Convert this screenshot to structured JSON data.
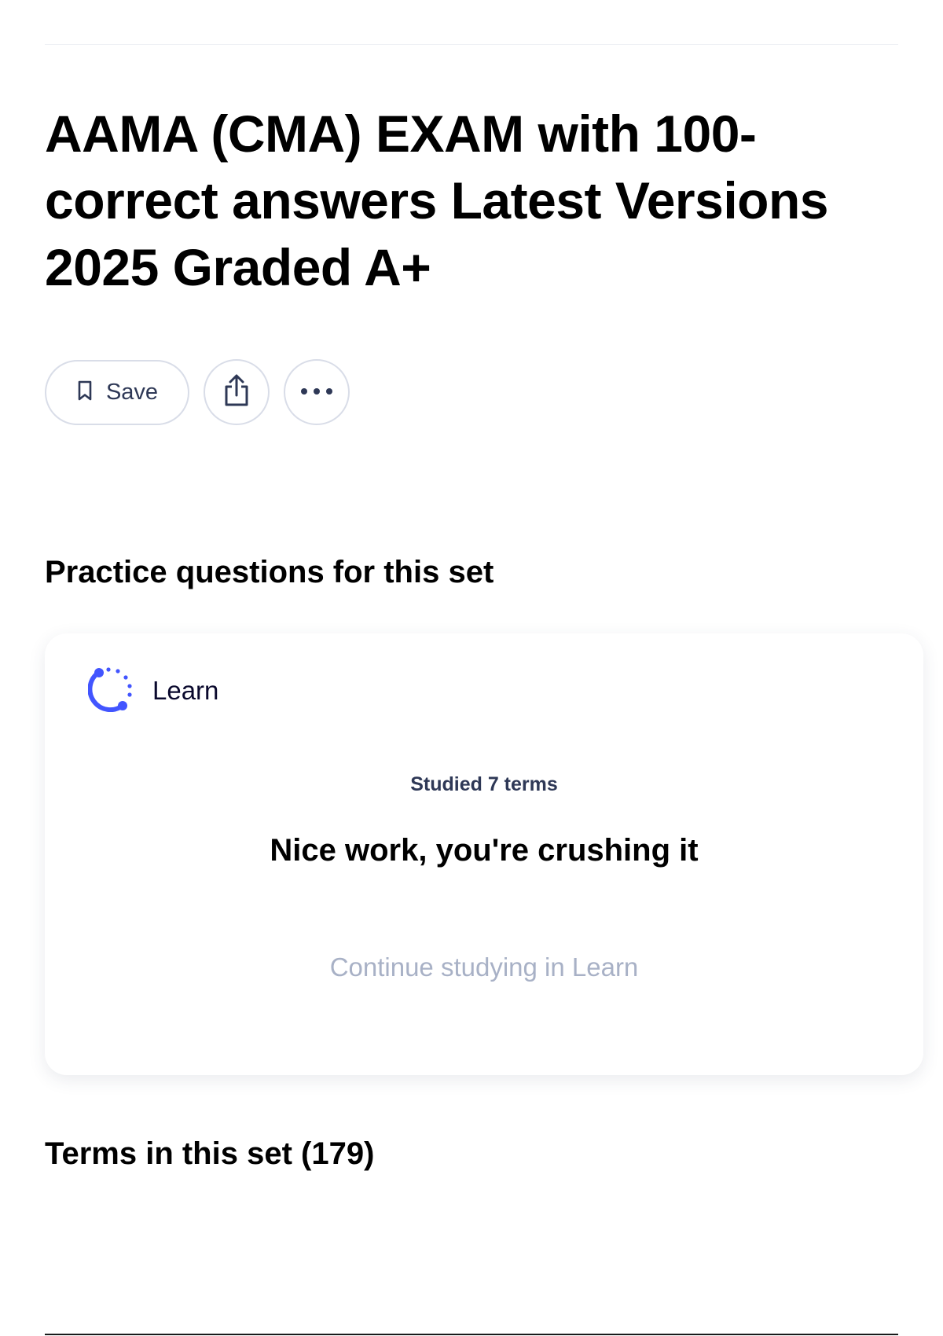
{
  "set": {
    "title": "AAMA (CMA) EXAM with 100-correct answers Latest Versions 2025 Graded A+"
  },
  "actions": {
    "save_label": "Save",
    "save_icon": "bookmark-icon",
    "share_icon": "share-icon",
    "more_icon": "more-horizontal-icon"
  },
  "practice": {
    "heading": "Practice questions for this set",
    "learn": {
      "icon": "learn-progress-icon",
      "label": "Learn",
      "studied_text": "Studied 7 terms",
      "message": "Nice work, you're crushing it",
      "continue_label": "Continue studying in Learn"
    }
  },
  "terms": {
    "heading": "Terms in this set (179)"
  },
  "colors": {
    "accent": "#4255ff",
    "text": "#000000",
    "muted": "#a8b1c6"
  }
}
